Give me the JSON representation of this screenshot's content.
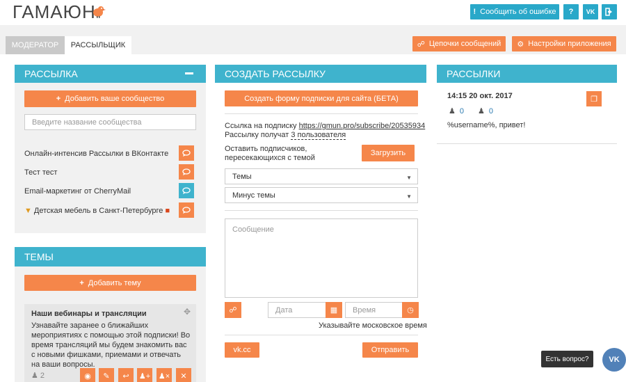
{
  "header": {
    "logo": "ГАМАЮН",
    "report_error": "Сообщить об ошибке",
    "help": "?",
    "vk": "VK"
  },
  "tabs": [
    {
      "label": "МОДЕРАТОР"
    },
    {
      "label": "РАССЫЛЬЩИК"
    }
  ],
  "actions": {
    "chains": "Цепочки сообщений",
    "settings": "Настройки приложения"
  },
  "mailing_panel": {
    "title": "РАССЫЛКА",
    "add_community": "Добавить ваше сообщество",
    "search_placeholder": "Введите название сообщества",
    "communities": [
      {
        "name": "Онлайн-интенсив Рассылки в ВКонтакте",
        "color": "#f5864a"
      },
      {
        "name": "Тест тест",
        "color": "#f5864a"
      },
      {
        "name": "Email-маркетинг от CherryMail",
        "color": "#3fb3cd"
      },
      {
        "name": "Детская мебель в Санкт-Петербурге",
        "color": "#f5864a"
      }
    ]
  },
  "themes_panel": {
    "title": "ТЕМЫ",
    "add_theme": "Добавить тему",
    "card": {
      "title": "Наши вебинары и трансляции",
      "text": "Узнавайте заранее о ближайших мероприятиях с помощью этой подписки! Во время трансляций мы будем знакомить вас с новыми фишками, приемами и отвечать на ваши вопросы.",
      "count": "2"
    }
  },
  "create_panel": {
    "title": "СОЗДАТЬ РАССЫЛКУ",
    "create_form": "Создать форму подписки для сайта (БЕТА)",
    "link_label": "Ссылка на подписку",
    "link_url": "https://gmun.pro/subscribe/20535934",
    "receives_label": "Рассылку получат",
    "receives_value": "3 пользователя",
    "leave_subscribers": "Оставить подписчиков, пересекающихся с темой",
    "upload": "Загрузить",
    "themes_select": "Темы",
    "minus_themes_select": "Минус темы",
    "message_placeholder": "Сообщение",
    "date_placeholder": "Дата",
    "time_placeholder": "Время",
    "moscow_time": "Указывайте московское время",
    "vkcc": "vk.cc",
    "send": "Отправить"
  },
  "mailings_panel": {
    "title": "РАССЫЛКИ",
    "item": {
      "datetime": "14:15 20 окт. 2017",
      "count_a": "0",
      "count_b": "0",
      "text": "%username%, привет!"
    }
  },
  "chat": {
    "question": "Есть вопрос?"
  }
}
